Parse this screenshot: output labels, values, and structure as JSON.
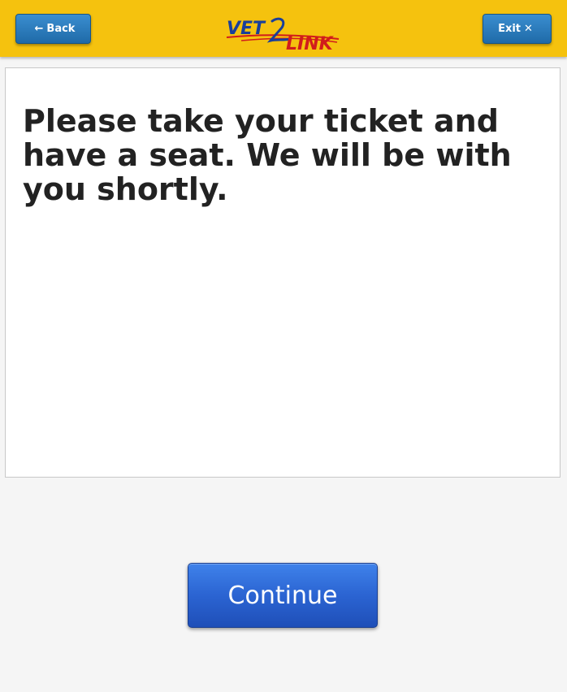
{
  "header": {
    "back_label": "Back",
    "back_icon": "arrow-left-icon",
    "exit_label": "Exit",
    "exit_icon": "close-icon",
    "logo": {
      "part1": "VET",
      "part2": "LINK",
      "colors": {
        "blue": "#1a3f9a",
        "red": "#d11c1c"
      }
    },
    "background_color": "#f5c20e"
  },
  "main": {
    "message": "Please take your ticket and have a seat. We will be with you shortly."
  },
  "footer": {
    "continue_label": "Continue"
  }
}
